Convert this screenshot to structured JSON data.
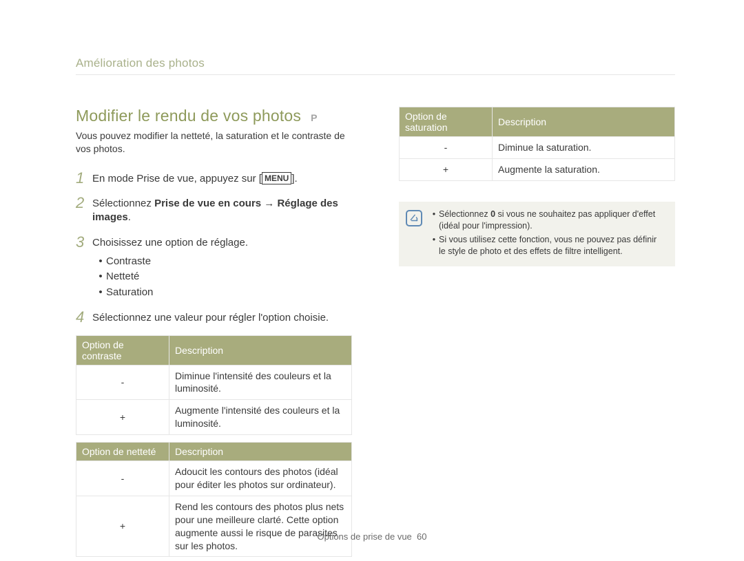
{
  "breadcrumb": "Amélioration des photos",
  "title": "Modifier le rendu de vos photos",
  "mode_badge": "P",
  "intro": "Vous pouvez modifier la netteté, la saturation et le contraste de vos photos.",
  "menu_key": "MENU",
  "steps": {
    "s1": {
      "num": "1",
      "pre": "En mode Prise de vue, appuyez sur [",
      "post": "]."
    },
    "s2": {
      "num": "2",
      "pre": "Sélectionnez ",
      "bold": "Prise de vue en cours → Réglage des images",
      "post": "."
    },
    "s3": {
      "num": "3",
      "text": "Choisissez une option de réglage.",
      "bullets": [
        "Contraste",
        "Netteté",
        "Saturation"
      ]
    },
    "s4": {
      "num": "4",
      "text": "Sélectionnez une valeur pour régler l'option choisie."
    }
  },
  "tables": {
    "contrast": {
      "h1": "Option de contraste",
      "h2": "Description",
      "rows": [
        {
          "opt": "-",
          "desc": "Diminue l'intensité des couleurs et la luminosité."
        },
        {
          "opt": "+",
          "desc": "Augmente l'intensité des couleurs et la luminosité."
        }
      ]
    },
    "sharpness": {
      "h1": "Option de netteté",
      "h2": "Description",
      "rows": [
        {
          "opt": "-",
          "desc": "Adoucit les contours des photos (idéal pour éditer les photos sur ordinateur)."
        },
        {
          "opt": "+",
          "desc": "Rend les contours des photos plus nets pour une meilleure clarté. Cette option augmente aussi le risque de parasites sur les photos."
        }
      ]
    },
    "saturation": {
      "h1": "Option de saturation",
      "h2": "Description",
      "rows": [
        {
          "opt": "-",
          "desc": "Diminue la saturation."
        },
        {
          "opt": "+",
          "desc": "Augmente la saturation."
        }
      ]
    }
  },
  "notes": {
    "n1_pre": "Sélectionnez ",
    "n1_bold": "0",
    "n1_post": " si vous ne souhaitez pas appliquer d'effet (idéal pour l'impression).",
    "n2": "Si vous utilisez cette fonction, vous ne pouvez pas définir le style de photo et des effets de filtre intelligent."
  },
  "footer": {
    "label": "Options de prise de vue",
    "page": "60"
  }
}
